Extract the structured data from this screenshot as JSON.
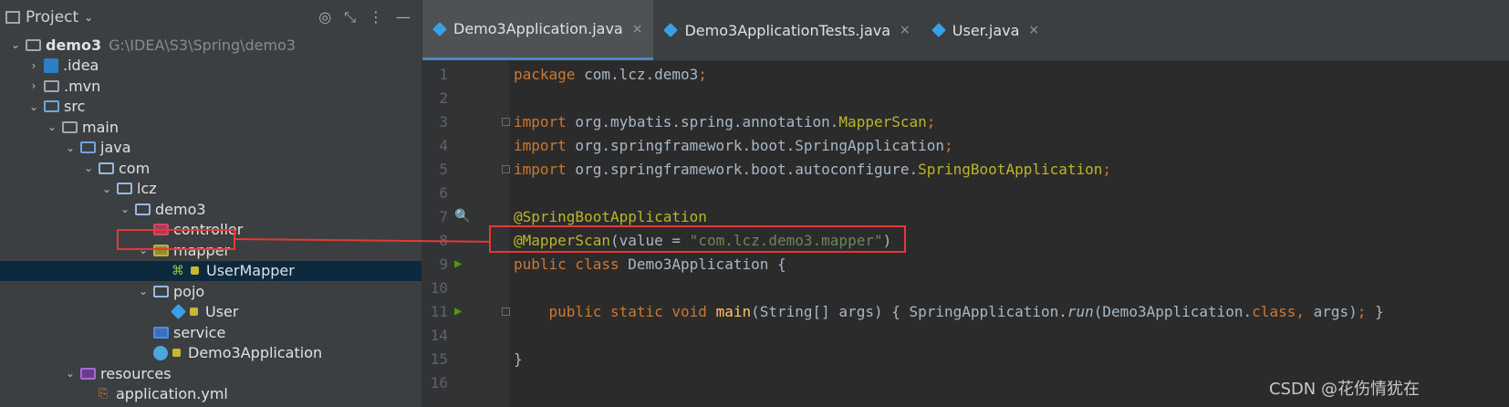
{
  "project_panel": {
    "title": "Project",
    "tools": [
      "◎",
      "⤡",
      "⋮",
      "—"
    ]
  },
  "tree": [
    {
      "label": "demo3",
      "path": "G:\\IDEA\\S3\\Spring\\demo3",
      "icon": "folder-icon",
      "arrow": "open",
      "indent": 0,
      "bold": true
    },
    {
      "label": ".idea",
      "icon": "idea-folder-icon",
      "arrow": "closed",
      "indent": 1
    },
    {
      "label": ".mvn",
      "icon": "folder-icon",
      "arrow": "closed",
      "indent": 1
    },
    {
      "label": "src",
      "icon": "source-folder-icon",
      "arrow": "open",
      "indent": 1
    },
    {
      "label": "main",
      "icon": "folder-icon",
      "arrow": "open",
      "indent": 2
    },
    {
      "label": "java",
      "icon": "source-root-icon",
      "arrow": "open",
      "indent": 3
    },
    {
      "label": "com",
      "icon": "package-icon",
      "arrow": "open",
      "indent": 4
    },
    {
      "label": "lcz",
      "icon": "package-icon",
      "arrow": "open",
      "indent": 5
    },
    {
      "label": "demo3",
      "icon": "package-icon",
      "arrow": "open",
      "indent": 6
    },
    {
      "label": "controller",
      "icon": "controller-package-icon",
      "arrow": "none",
      "indent": 7
    },
    {
      "label": "mapper",
      "icon": "mapper-package-icon",
      "arrow": "open",
      "indent": 7
    },
    {
      "label": "UserMapper",
      "icon": "interface-icon",
      "arrow": "none",
      "indent": 8,
      "lock": true,
      "selected": true
    },
    {
      "label": "pojo",
      "icon": "package-icon",
      "arrow": "open",
      "indent": 7
    },
    {
      "label": "User",
      "icon": "class-icon",
      "arrow": "none",
      "indent": 8,
      "lock": true
    },
    {
      "label": "service",
      "icon": "service-package-icon",
      "arrow": "none",
      "indent": 7
    },
    {
      "label": "Demo3Application",
      "icon": "spring-app-icon",
      "arrow": "none",
      "indent": 7,
      "lock": true
    },
    {
      "label": "resources",
      "icon": "resources-folder-icon",
      "arrow": "open",
      "indent": 3
    },
    {
      "label": "application.yml",
      "icon": "yaml-icon",
      "arrow": "none",
      "indent": 4
    }
  ],
  "tabs": [
    {
      "label": "Demo3Application.java",
      "close": "×",
      "active": true
    },
    {
      "label": "Demo3ApplicationTests.java",
      "close": "×",
      "active": false
    },
    {
      "label": "User.java",
      "close": "×",
      "active": false
    }
  ],
  "code_lines": [
    {
      "num": "1",
      "html": "<span class=\"kw\">package</span> com.lcz.demo3<span class=\"kw\">;</span>"
    },
    {
      "num": "2",
      "html": ""
    },
    {
      "num": "3",
      "html": "<span class=\"kw\">import</span> org.mybatis.spring.annotation.<span class=\"ann\">MapperScan</span><span class=\"kw\">;</span>",
      "fold": true
    },
    {
      "num": "4",
      "html": "<span class=\"kw\">import</span> org.springframework.boot.SpringApplication<span class=\"kw\">;</span>"
    },
    {
      "num": "5",
      "html": "<span class=\"kw\">import</span> org.springframework.boot.autoconfigure.<span class=\"ann\">SpringBootApplication</span><span class=\"kw\">;</span>",
      "fold": true
    },
    {
      "num": "6",
      "html": ""
    },
    {
      "num": "7",
      "html": "<span class=\"ann\">@SpringBootApplication</span>",
      "gutter": "🔍"
    },
    {
      "num": "8",
      "html": "<span class=\"ann\">@MapperScan</span>(value = <span class=\"str\">\"com.lcz.demo3.mapper\"</span>)"
    },
    {
      "num": "9",
      "html": "<span class=\"kw\">public class</span> Demo3Application {",
      "gutter": "▶"
    },
    {
      "num": "10",
      "html": ""
    },
    {
      "num": "11",
      "html": "    <span class=\"kw\">public static void</span> <span class=\"fn\">main</span>(String[] args) { SpringApplication.<span class=\"it\">run</span>(Demo3Application.<span class=\"kw\">class,</span> args)<span class=\"kw\">;</span> }",
      "gutter": "▶",
      "fold": true
    },
    {
      "num": "14",
      "html": ""
    },
    {
      "num": "15",
      "html": "}"
    },
    {
      "num": "16",
      "html": ""
    }
  ],
  "watermark": "CSDN @花伤情犹在"
}
